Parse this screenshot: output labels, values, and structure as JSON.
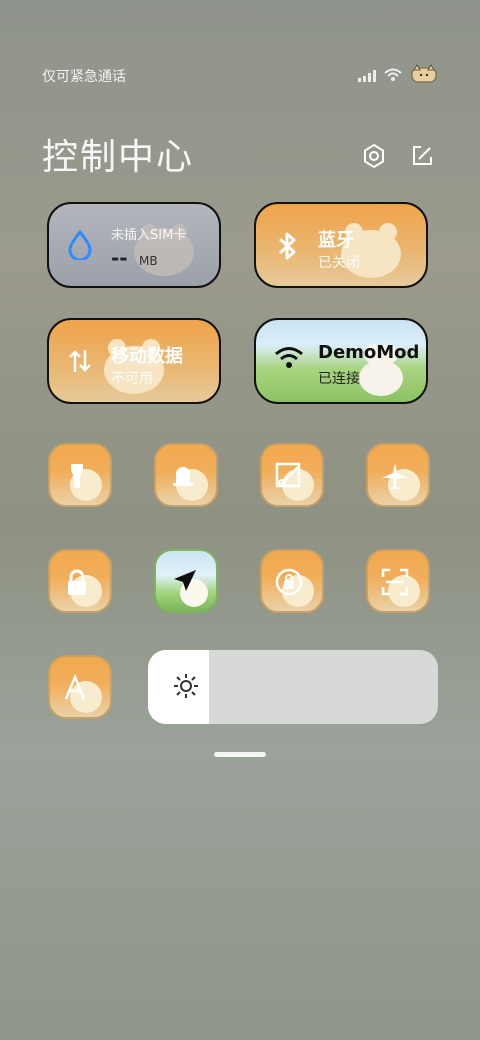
{
  "status": {
    "carrier_text": "仅可紧急通话",
    "icons": [
      "signal-icon",
      "wifi-icon",
      "cat-avatar-icon"
    ]
  },
  "header": {
    "title": "控制中心",
    "actions": [
      "settings-icon",
      "edit-icon"
    ]
  },
  "tiles": [
    {
      "id": "mobile-data-usage",
      "main": "--",
      "unit": "MB",
      "sub": "未插入SIM卡"
    },
    {
      "id": "bluetooth",
      "main": "蓝牙",
      "sub": "已关闭"
    },
    {
      "id": "mobile-data",
      "main": "移动数据",
      "sub": "不可用"
    },
    {
      "id": "wifi",
      "main": "DemoMod",
      "sub": "已连接"
    }
  ],
  "round_buttons": [
    {
      "name": "flashlight"
    },
    {
      "name": "bell"
    },
    {
      "name": "screenshot"
    },
    {
      "name": "airplane"
    },
    {
      "name": "lock"
    },
    {
      "name": "location"
    },
    {
      "name": "rotation-lock"
    },
    {
      "name": "scan"
    },
    {
      "name": "font-size"
    }
  ],
  "brightness": {
    "level_fraction": 0.21
  },
  "colors": {
    "accent_blue": "#2e8bff",
    "tile_orange": "#f0a34b",
    "location_green": "#7ab55a"
  }
}
